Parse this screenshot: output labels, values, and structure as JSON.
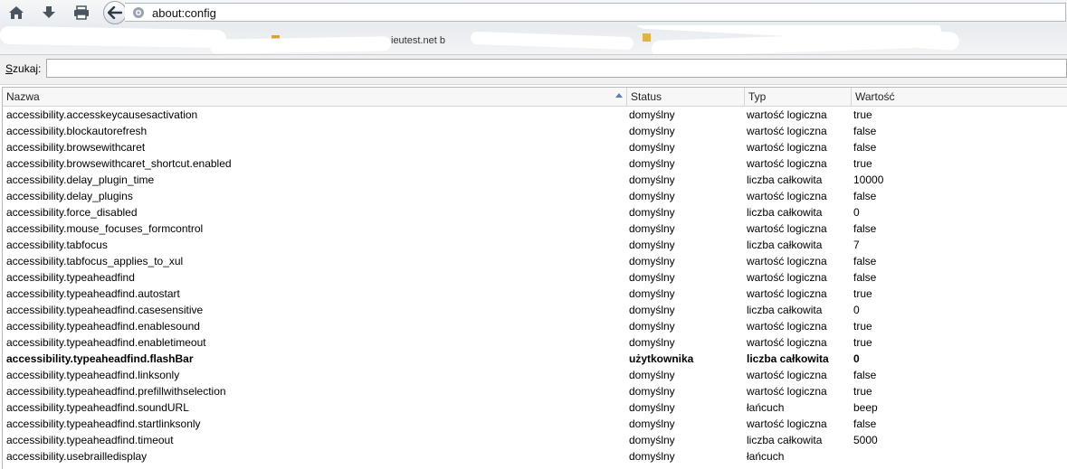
{
  "browser": {
    "url": "about:config",
    "bookmark_fragment": "ieutest.net b"
  },
  "search": {
    "label_access_key": "S",
    "label_rest": "zukaj:",
    "value": ""
  },
  "table": {
    "columns": [
      "Nazwa",
      "Status",
      "Typ",
      "Wartość"
    ],
    "sorted_column": "Nazwa",
    "rows": [
      {
        "name": "accessibility.accesskeycausesactivation",
        "status": "domyślny",
        "type": "wartość logiczna",
        "value": "true",
        "modified": false
      },
      {
        "name": "accessibility.blockautorefresh",
        "status": "domyślny",
        "type": "wartość logiczna",
        "value": "false",
        "modified": false
      },
      {
        "name": "accessibility.browsewithcaret",
        "status": "domyślny",
        "type": "wartość logiczna",
        "value": "false",
        "modified": false
      },
      {
        "name": "accessibility.browsewithcaret_shortcut.enabled",
        "status": "domyślny",
        "type": "wartość logiczna",
        "value": "true",
        "modified": false
      },
      {
        "name": "accessibility.delay_plugin_time",
        "status": "domyślny",
        "type": "liczba całkowita",
        "value": "10000",
        "modified": false
      },
      {
        "name": "accessibility.delay_plugins",
        "status": "domyślny",
        "type": "wartość logiczna",
        "value": "false",
        "modified": false
      },
      {
        "name": "accessibility.force_disabled",
        "status": "domyślny",
        "type": "liczba całkowita",
        "value": "0",
        "modified": false
      },
      {
        "name": "accessibility.mouse_focuses_formcontrol",
        "status": "domyślny",
        "type": "wartość logiczna",
        "value": "false",
        "modified": false
      },
      {
        "name": "accessibility.tabfocus",
        "status": "domyślny",
        "type": "liczba całkowita",
        "value": "7",
        "modified": false
      },
      {
        "name": "accessibility.tabfocus_applies_to_xul",
        "status": "domyślny",
        "type": "wartość logiczna",
        "value": "false",
        "modified": false
      },
      {
        "name": "accessibility.typeaheadfind",
        "status": "domyślny",
        "type": "wartość logiczna",
        "value": "false",
        "modified": false
      },
      {
        "name": "accessibility.typeaheadfind.autostart",
        "status": "domyślny",
        "type": "wartość logiczna",
        "value": "true",
        "modified": false
      },
      {
        "name": "accessibility.typeaheadfind.casesensitive",
        "status": "domyślny",
        "type": "liczba całkowita",
        "value": "0",
        "modified": false
      },
      {
        "name": "accessibility.typeaheadfind.enablesound",
        "status": "domyślny",
        "type": "wartość logiczna",
        "value": "true",
        "modified": false
      },
      {
        "name": "accessibility.typeaheadfind.enabletimeout",
        "status": "domyślny",
        "type": "wartość logiczna",
        "value": "true",
        "modified": false
      },
      {
        "name": "accessibility.typeaheadfind.flashBar",
        "status": "użytkownika",
        "type": "liczba całkowita",
        "value": "0",
        "modified": true
      },
      {
        "name": "accessibility.typeaheadfind.linksonly",
        "status": "domyślny",
        "type": "wartość logiczna",
        "value": "false",
        "modified": false
      },
      {
        "name": "accessibility.typeaheadfind.prefillwithselection",
        "status": "domyślny",
        "type": "wartość logiczna",
        "value": "true",
        "modified": false
      },
      {
        "name": "accessibility.typeaheadfind.soundURL",
        "status": "domyślny",
        "type": "łańcuch",
        "value": "beep",
        "modified": false
      },
      {
        "name": "accessibility.typeaheadfind.startlinksonly",
        "status": "domyślny",
        "type": "wartość logiczna",
        "value": "false",
        "modified": false
      },
      {
        "name": "accessibility.typeaheadfind.timeout",
        "status": "domyślny",
        "type": "liczba całkowita",
        "value": "5000",
        "modified": false
      },
      {
        "name": "accessibility.usebrailledisplay",
        "status": "domyślny",
        "type": "łańcuch",
        "value": "",
        "modified": false
      }
    ]
  },
  "icons": {
    "home": "home-icon",
    "download": "download-arrow-icon",
    "print": "printer-icon",
    "back": "back-arrow-icon",
    "site": "globe-icon",
    "sort": "sort-ascending-icon"
  }
}
